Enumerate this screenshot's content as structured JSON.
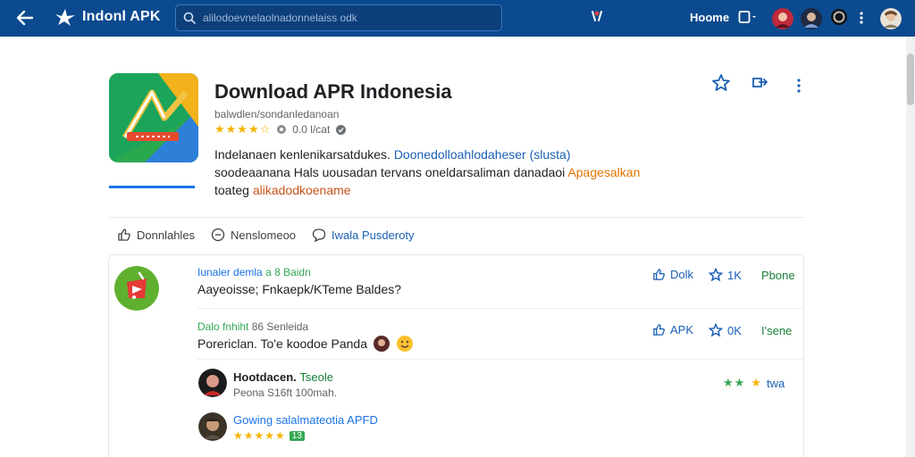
{
  "topbar": {
    "brand": "Indonl APK",
    "search_placeholder": "alilodoevnelaolnadonnelaiss odk",
    "home": "Hoome"
  },
  "app": {
    "title": "Download APR Indonesia",
    "subtitle": "balwdlen/sondanledanoan",
    "stars": "★★★★☆",
    "rating_count": "0.0 l/cat",
    "desc_line1_a": "Indelanaen kenlenikarsatdukes. ",
    "desc_line1_b": "Doonedolloahlodaheser (slusta)",
    "desc_line2_a": "soodeaanana Hals uousadan tervans oneldarsaliman danadaoi ",
    "desc_line2_b": "Apagesalkan",
    "desc_line3_a": "toateg ",
    "desc_line3_b": "alikadodkoename"
  },
  "secondary_actions": {
    "download": "Donnlahles",
    "remove": "Nenslomeoo",
    "feedback": "Iwala Pusderoty"
  },
  "comments": [
    {
      "meta_name": "Iunaler demla",
      "meta_rest": "a 8 Baidn",
      "text": "Aayeoisse; Fnkaepk/KTeme Baldes?",
      "like": "Dolk",
      "star": "1K",
      "reply": "Pbone"
    },
    {
      "meta_name": "Dalo fnhiht",
      "meta_rest": "86 Senleida",
      "text": "Porericlan. To'e koodoe Panda",
      "like": "APK",
      "star": "0K",
      "reply": "I'sene"
    }
  ],
  "replies": [
    {
      "name": "Hootdacen.",
      "name_extra": "Tseole",
      "sub": "Peona S16ft 100mah.",
      "stars": "★★",
      "tail": "twa"
    },
    {
      "name_link": "Gowing salalmateotia APFD",
      "stars": "★★★★★",
      "badge": "13"
    }
  ],
  "colors": {
    "topbar": "#0b4a8f",
    "accent": "#1a73e8",
    "star": "#f4b400",
    "green": "#34a853"
  }
}
